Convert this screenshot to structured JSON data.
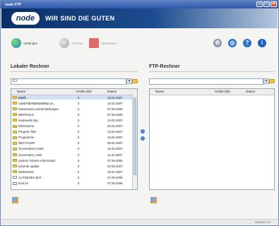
{
  "window": {
    "title": "node FTP",
    "min": "–",
    "max": "□",
    "close": "×"
  },
  "banner": {
    "logo": "node",
    "slogan": "WIR SIND DIE GUTEN"
  },
  "toolbar": {
    "connect": "Verbinden",
    "disconnect": "Trennen",
    "abort": "Abbrechen",
    "icons": [
      "settings-icon",
      "globe-icon",
      "help-icon",
      "info-icon"
    ]
  },
  "local": {
    "header": "Lokaler Rechner",
    "path": "C:\\",
    "columns": {
      "name": "Name",
      "size": "Größe (kb)",
      "date": "Datum"
    },
    "rows": [
      {
        "name": "Bakfit",
        "size": "0",
        "date": "13.02.2007",
        "type": "folder"
      },
      {
        "name": "cw8570b0fa90fab8f5acca...",
        "size": "0",
        "date": "13.02.2007",
        "type": "folder"
      },
      {
        "name": "Dokumente und Einstellungen",
        "size": "0",
        "date": "07.09.2006",
        "type": "folder"
      },
      {
        "name": "IBMTOOLS",
        "size": "0",
        "date": "07.09.2006",
        "type": "folder"
      },
      {
        "name": "modswebl.tmp",
        "size": "0",
        "date": "13.02.2007",
        "type": "folder"
      },
      {
        "name": "MSOCache",
        "size": "0",
        "date": "26.01.2007",
        "type": "folder"
      },
      {
        "name": "Program files",
        "size": "0",
        "date": "13.02.2007",
        "type": "folder"
      },
      {
        "name": "Programme",
        "size": "0",
        "date": "15.02.2007",
        "type": "folder"
      },
      {
        "name": "RECYCLER",
        "size": "0",
        "date": "09.02.2007",
        "type": "folder"
      },
      {
        "name": "Screenshots Inode",
        "size": "0",
        "date": "15.02.2007",
        "type": "folder"
      },
      {
        "name": "Screenshot_USB",
        "size": "0",
        "date": "11.02.2007",
        "type": "folder"
      },
      {
        "name": "System Volume Information",
        "size": "0",
        "date": "07.09.2006",
        "type": "folder"
      },
      {
        "name": "tele2ute update",
        "size": "0",
        "date": "02.02.2007",
        "type": "folder"
      },
      {
        "name": "WINDOWS",
        "size": "0",
        "date": "15.02.2007",
        "type": "folder"
      },
      {
        "name": "AUTOEXEC.BAT",
        "size": "0",
        "date": "07.09.2006",
        "type": "file"
      },
      {
        "name": "boot.ini",
        "size": "0",
        "date": "07.09.2006",
        "type": "file"
      }
    ]
  },
  "remote": {
    "header": "FTP-Rechner",
    "path": "",
    "columns": {
      "name": "Name",
      "size": "Größe (kb)",
      "date": "Datum"
    }
  },
  "transfer": {
    "up": "›",
    "down": "‹"
  },
  "status": {
    "version": "Version 1.0"
  }
}
